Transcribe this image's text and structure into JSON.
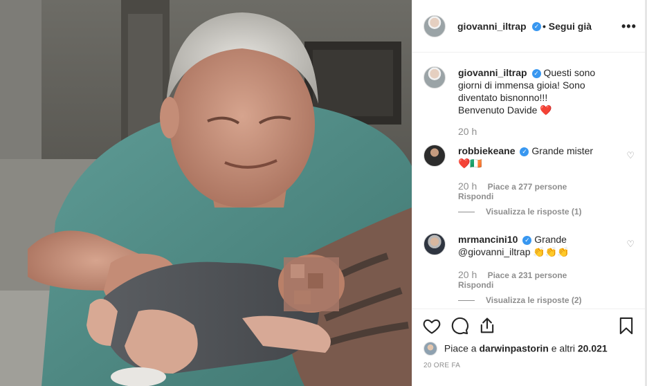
{
  "post": {
    "author": "giovanni_iltrap",
    "follow_label": "• Segui già",
    "more_icon": "more-horizontal-icon"
  },
  "caption": {
    "username": "giovanni_iltrap",
    "text": "Questi sono giorni di immensa gioia! Sono diventato bisnonno!!!",
    "text2": "Benvenuto Davide ❤️",
    "time": "20 h"
  },
  "comments": [
    {
      "username": "robbiekeane",
      "text": "Grande mister",
      "text2": "❤️🇮🇪",
      "time": "20 h",
      "likes": "Piace a 277 persone",
      "reply": "Rispondi",
      "view_replies": "Visualizza le risposte (1)"
    },
    {
      "username": "mrmancini10",
      "text": "Grande",
      "text2": "@giovanni_iltrap 👏👏👏",
      "time": "20 h",
      "likes": "Piace a 231 persone",
      "reply": "Rispondi",
      "view_replies": "Visualizza le risposte (2)"
    }
  ],
  "actions": {
    "like_icon": "heart-icon",
    "comment_icon": "comment-icon",
    "share_icon": "share-icon",
    "save_icon": "bookmark-icon"
  },
  "likes_summary": {
    "prefix": "Piace a",
    "user": "darwinpastorin",
    "suffix": "e altri",
    "count": "20.021"
  },
  "timestamp": "20 ORE FA"
}
